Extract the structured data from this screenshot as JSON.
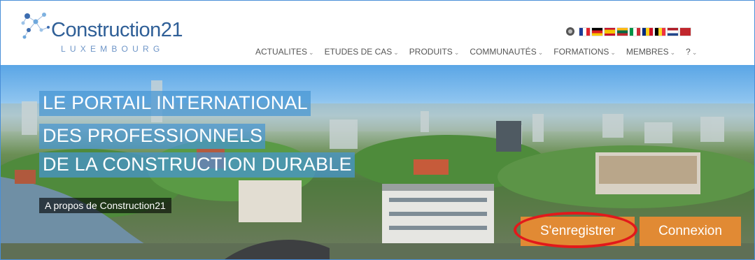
{
  "brand": {
    "name": "Construction21",
    "subtitle": "LUXEMBOURG",
    "colors": {
      "name": "#2f5f97",
      "subtitle": "#6f96c8"
    }
  },
  "languages": {
    "globe_icon": "globe-icon",
    "flags": [
      "france",
      "germany",
      "spain",
      "lithuania",
      "italy",
      "romania",
      "belgium",
      "netherlands",
      "morocco"
    ]
  },
  "nav": {
    "items": [
      "ACTUALITES",
      "ETUDES DE CAS",
      "PRODUITS",
      "COMMUNAUTÉS",
      "FORMATIONS",
      "MEMBRES",
      "?"
    ]
  },
  "hero": {
    "taglines": [
      "LE PORTAIL INTERNATIONAL",
      "DES PROFESSIONNELS",
      "DE LA CONSTRUCTION DURABLE"
    ],
    "about_label": "A propos de Construction21",
    "register_label": "S'enregistrer",
    "login_label": "Connexion",
    "accent": "#e18a34",
    "highlight": "#e2191b"
  }
}
